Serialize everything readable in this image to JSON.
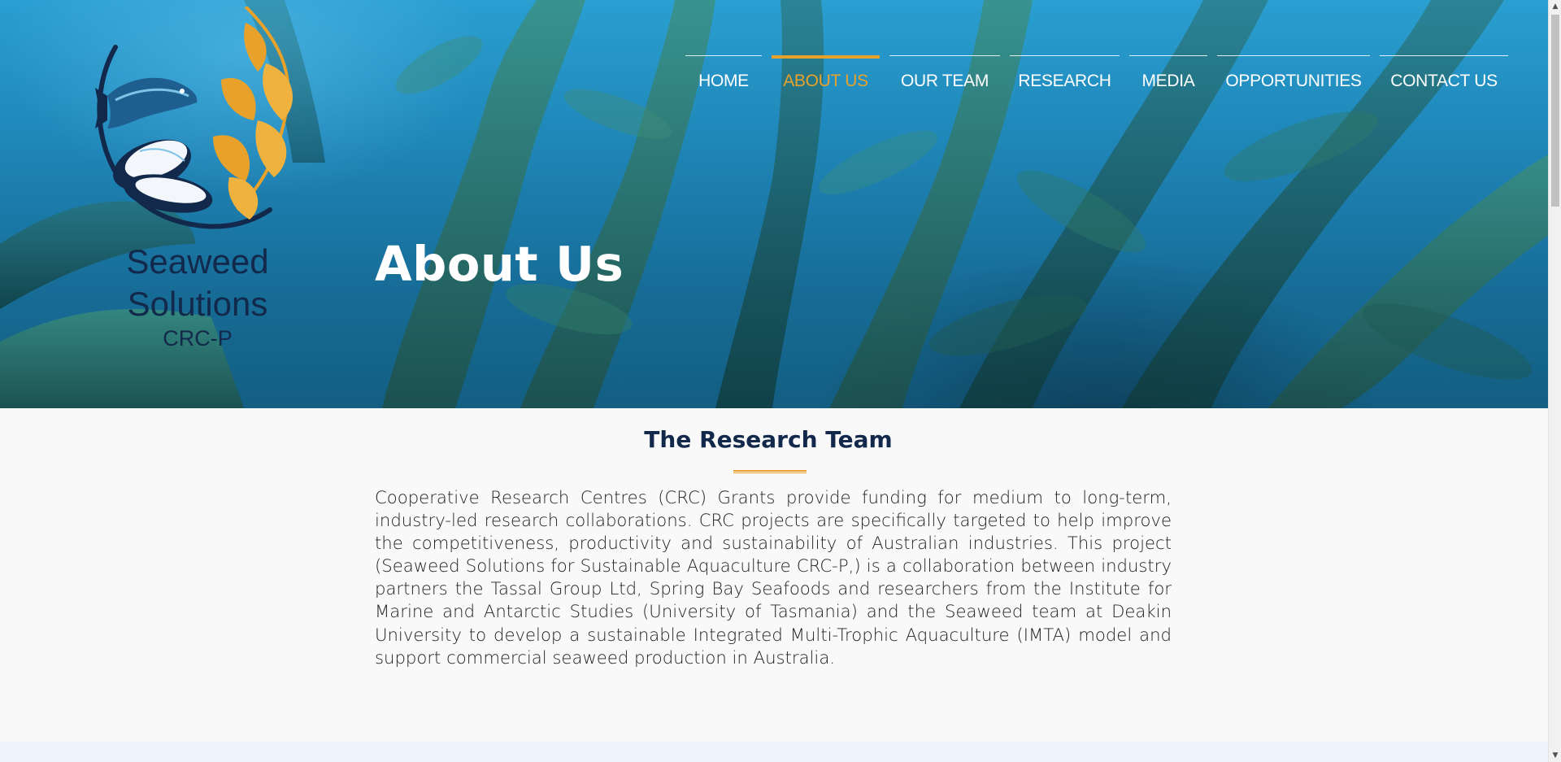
{
  "brand": {
    "line1": "Seaweed",
    "line2": "Solutions",
    "line3": "CRC-P"
  },
  "nav": {
    "items": [
      {
        "label": "HOME",
        "active": false
      },
      {
        "label": "ABOUT US",
        "active": true
      },
      {
        "label": "OUR TEAM",
        "active": false
      },
      {
        "label": "RESEARCH",
        "active": false
      },
      {
        "label": "MEDIA",
        "active": false
      },
      {
        "label": "OPPORTUNITIES",
        "active": false
      },
      {
        "label": "CONTACT US",
        "active": false
      }
    ]
  },
  "hero": {
    "title": "About Us"
  },
  "section": {
    "title": "The Research Team",
    "body": "Cooperative Research Centres (CRC) Grants provide funding for medium to long-term, industry-led research collaborations. CRC projects are specifically targeted to help improve the competitiveness, productivity and sustainability of Australian industries. This project (Seaweed Solutions for Sustainable Aquaculture CRC-P,) is a collaboration between industry partners the Tassal Group Ltd, Spring Bay Seafoods and researchers from the Institute for Marine and Antarctic Studies (University of Tasmania) and the Seaweed team at Deakin University to develop a sustainable Integrated Multi-Trophic Aquaculture (IMTA) model and support commercial seaweed production in Australia."
  },
  "colors": {
    "accent": "#e8a22c",
    "navy": "#13294b",
    "ocean": "#1f86b8"
  }
}
